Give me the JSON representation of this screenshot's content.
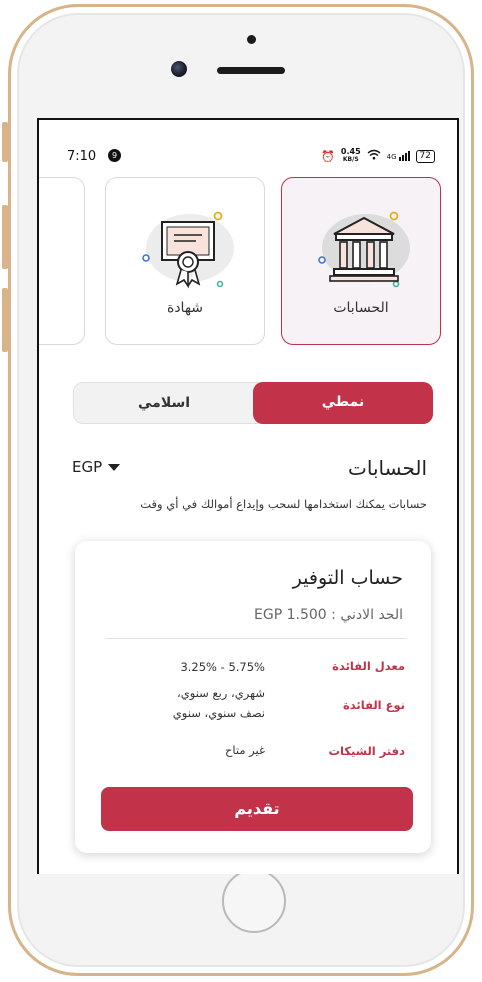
{
  "status_bar": {
    "time": "7:10",
    "notif_count": "9",
    "net_speed": "0.45",
    "net_unit": "KB/S",
    "network": "4G",
    "battery": "72"
  },
  "products": [
    {
      "label": "الحسابات",
      "icon": "bank-icon",
      "selected": true
    },
    {
      "label": "شهادة",
      "icon": "certificate-icon",
      "selected": false
    }
  ],
  "toggle": {
    "left": "اسلامي",
    "right": "نمطي",
    "active": "right"
  },
  "section": {
    "title": "الحسابات",
    "currency": "EGP",
    "description": "حسابات يمكنك استخدامها لسحب وإيداع أموالك في أي وقت"
  },
  "account": {
    "name": "حساب التوفير",
    "minimum": "الحد الادني : EGP 1.500",
    "rows": [
      {
        "label": "معدل الفائدة",
        "value": "5.75% - 3.25%"
      },
      {
        "label": "نوع الفائدة",
        "value_line1": "شهري، ربع سنوي،",
        "value_line2": "نصف سنوي، سنوي"
      },
      {
        "label": "دفتر الشيكات",
        "value": "غير متاح"
      }
    ],
    "apply_label": "تقديم"
  },
  "colors": {
    "accent": "#c23349",
    "frame": "#d7b48a"
  }
}
